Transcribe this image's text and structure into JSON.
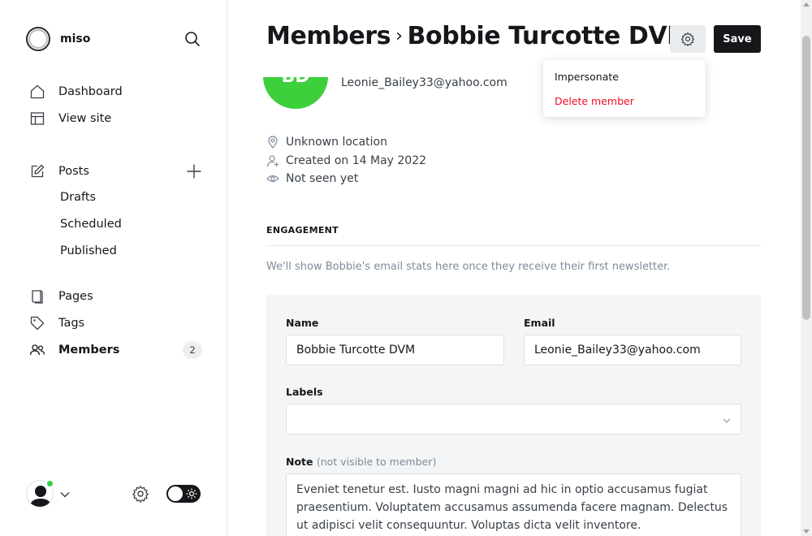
{
  "app": {
    "brand_name": "miso"
  },
  "sidebar": {
    "items": [
      {
        "label": "Dashboard",
        "icon": "home-icon"
      },
      {
        "label": "View site",
        "icon": "layout-icon"
      },
      {
        "label": "Posts",
        "icon": "edit-icon"
      },
      {
        "label": "Drafts"
      },
      {
        "label": "Scheduled"
      },
      {
        "label": "Published"
      },
      {
        "label": "Pages",
        "icon": "page-icon"
      },
      {
        "label": "Tags",
        "icon": "tag-icon"
      },
      {
        "label": "Members",
        "icon": "members-icon",
        "count": "2",
        "active": true
      }
    ]
  },
  "header": {
    "crumb_root": "Members",
    "crumb_separator": "›",
    "member_name": "Bobbie Turcotte DVM",
    "save_label": "Save"
  },
  "settings_menu": {
    "impersonate": "Impersonate",
    "delete": "Delete member"
  },
  "member": {
    "initials": "BD",
    "email": "Leonie_Bailey33@yahoo.com",
    "location": "Unknown location",
    "created": "Created on 14 May 2022",
    "seen": "Not seen yet"
  },
  "engagement": {
    "heading": "ENGAGEMENT",
    "message": "We'll show Bobbie's email stats here once they receive their first newsletter."
  },
  "form": {
    "name_label": "Name",
    "name_value": "Bobbie Turcotte DVM",
    "email_label": "Email",
    "email_value": "Leonie_Bailey33@yahoo.com",
    "labels_label": "Labels",
    "note_label": "Note",
    "note_hint": "(not visible to member)",
    "note_value": "Eveniet tenetur est. Iusto magni magni ad hic in optio accusamus fugiat praesentium. Voluptatem accusamus assumenda facere magnam. Delectus ut adipisci velit consequuntur. Voluptas dicta velit inventore."
  },
  "colors": {
    "accent_dark": "#15171a",
    "danger": "#f50b23",
    "avatar_green": "#3ecf3d",
    "online_dot": "#30cf43"
  }
}
